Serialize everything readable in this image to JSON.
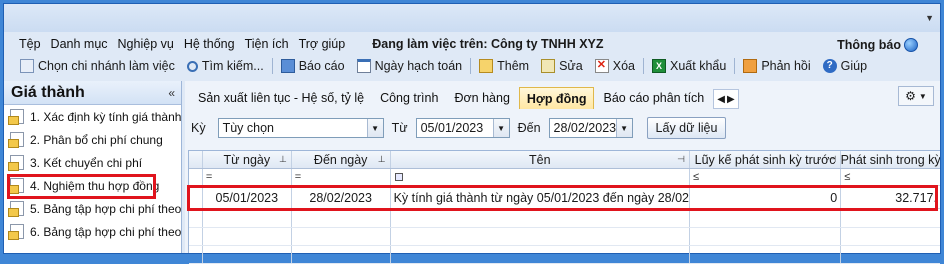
{
  "menu": {
    "items": [
      "Tệp",
      "Danh mục",
      "Nghiệp vụ",
      "Hệ thống",
      "Tiện ích",
      "Trợ giúp"
    ],
    "workspace_label": "Đang làm việc trên: Công ty TNHH XYZ",
    "notify_label": "Thông báo"
  },
  "toolbar": {
    "branch": "Chọn chi nhánh làm việc",
    "search": "Tìm kiếm...",
    "report": "Báo cáo",
    "posting_date": "Ngày hạch toán",
    "add": "Thêm",
    "edit": "Sửa",
    "delete": "Xóa",
    "export": "Xuất khẩu",
    "feedback": "Phản hồi",
    "help": "Giúp"
  },
  "sidebar": {
    "title": "Giá thành",
    "items": [
      "1. Xác định kỳ tính giá thành",
      "2. Phân bổ chi phí chung",
      "3. Kết chuyển chi phí",
      "4. Nghiệm thu hợp đồng",
      "5. Bảng tập hợp chi phí theo...",
      "6. Bảng tập hợp chi phí theo..."
    ]
  },
  "tabs": [
    "Sản xuất liên tục - Hệ số, tỷ lệ",
    "Công trình",
    "Đơn hàng",
    "Hợp đồng",
    "Báo cáo phân tích"
  ],
  "active_tab": "Hợp đồng",
  "filters": {
    "period_label": "Kỳ",
    "period_value": "Tùy chọn",
    "from_label": "Từ",
    "from_value": "05/01/2023",
    "to_label": "Đến",
    "to_value": "28/02/2023",
    "fetch_label": "Lấy dữ liệu"
  },
  "grid": {
    "columns": [
      "Từ ngày",
      "Đến ngày",
      "Tên",
      "Lũy kế phát sinh kỳ trước",
      "Phát sinh trong kỳ"
    ],
    "filter_ops": [
      "=",
      "=",
      "",
      "≤",
      "≤"
    ],
    "rows": [
      {
        "from": "05/01/2023",
        "to": "28/02/2023",
        "name": "Kỳ tính giá thành từ ngày 05/01/2023 đến ngày 28/02/",
        "prior": "0",
        "period": "32.717."
      }
    ]
  },
  "colors": {
    "highlight": "#e0141d",
    "frame": "#3f86d6",
    "active_tab": "#ffe7a3"
  }
}
